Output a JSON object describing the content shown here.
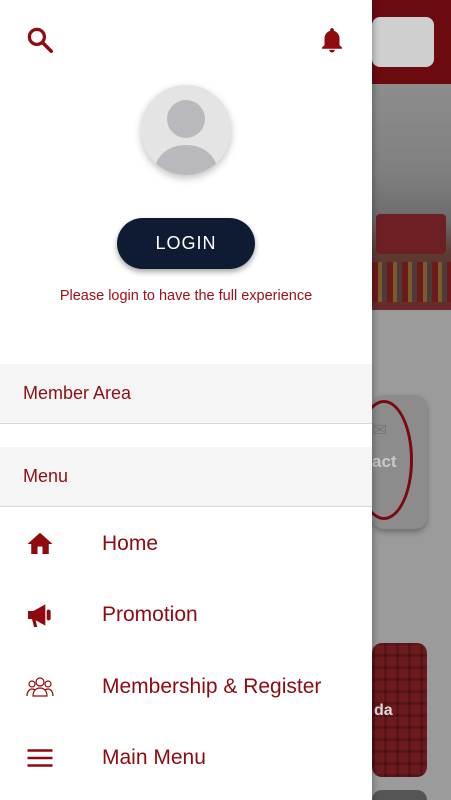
{
  "colors": {
    "accent": "#8f0a10",
    "login_button": "#0f1a33",
    "section_background": "#f5f5f5"
  },
  "header": {
    "search_icon": "search-icon",
    "notification_icon": "bell-icon"
  },
  "profile": {
    "avatar_icon": "user-placeholder-icon",
    "login_label": "LOGIN",
    "login_hint": "Please login to have the full experience"
  },
  "sections": {
    "member_area": "Member Area",
    "menu": "Menu"
  },
  "menu_items": [
    {
      "label": "Home",
      "icon": "home-icon"
    },
    {
      "label": "Promotion",
      "icon": "megaphone-icon"
    },
    {
      "label": "Membership & Register",
      "icon": "group-icon"
    },
    {
      "label": "Main Menu",
      "icon": "hamburger-menu-icon"
    }
  ],
  "background": {
    "card_1_label": "act",
    "card_2_label": "da"
  }
}
